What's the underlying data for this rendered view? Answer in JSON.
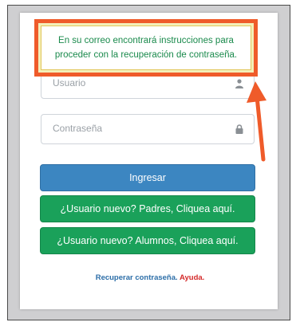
{
  "notice": {
    "text": "En su correo encontrará instrucciones para proceder con la recuperación de contraseña."
  },
  "form": {
    "username_placeholder": "Usuario",
    "password_placeholder": "Contraseña",
    "login_label": "Ingresar",
    "new_parents_label": "¿Usuario nuevo? Padres, Cliquea aquí.",
    "new_students_label": "¿Usuario nuevo? Alumnos, Cliquea aquí."
  },
  "footer": {
    "recover_label": "Recuperar contraseña.",
    "help_label": "Ayuda."
  },
  "colors": {
    "highlight_border": "#ef5b2a",
    "primary_button": "#3c86c1",
    "success_button": "#1aa15a",
    "notice_text": "#1a8a4c",
    "help_link": "#d42a2a"
  },
  "icons": {
    "username": "user-icon",
    "password": "lock-icon",
    "annotation": "annotation-arrow-icon"
  }
}
